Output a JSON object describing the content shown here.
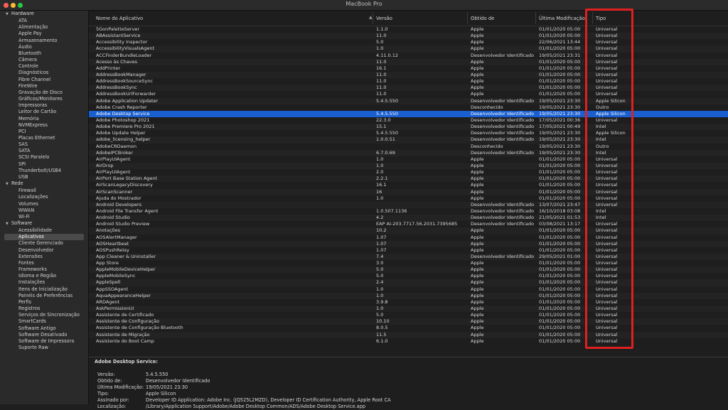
{
  "window": {
    "title": "MacBook Pro"
  },
  "sidebar": {
    "groups": [
      {
        "label": "Hardware",
        "items": [
          "ATA",
          "Alimentação",
          "Apple Pay",
          "Armazenamento",
          "Áudio",
          "Bluetooth",
          "Câmera",
          "Controle",
          "Diagnósticos",
          "Fibre Channel",
          "FireWire",
          "Gravação de Disco",
          "Gráficos/Monitores",
          "Impressoras",
          "Leitor de Cartão",
          "Memória",
          "NVMExpress",
          "PCI",
          "Placas Ethernet",
          "SAS",
          "SATA",
          "SCSI Paralelo",
          "SPI",
          "Thunderbolt/USB4",
          "USB"
        ]
      },
      {
        "label": "Rede",
        "items": [
          "Firewall",
          "Localizações",
          "Volumes",
          "WWAN",
          "Wi-Fi"
        ]
      },
      {
        "label": "Software",
        "items": [
          "Acessibilidade",
          "Aplicativos",
          "Cliente Gerenciado",
          "Desenvolvedor",
          "Extensões",
          "Fontes",
          "Frameworks",
          "Idioma e Região",
          "Instalações",
          "Itens de Inicialização",
          "Painéis de Preferências",
          "Perfis",
          "Registros",
          "Serviços de Sincronização",
          "SmartCards",
          "Software Antigo",
          "Software Desativado",
          "Software de Impressora",
          "Suporte Raw"
        ]
      }
    ],
    "selected": "Aplicativos"
  },
  "table": {
    "columns": [
      "Nome do Aplicativo",
      "Versão",
      "Obtido de",
      "Última Modificação",
      "Tipo"
    ],
    "selected_index": 15,
    "rows": [
      [
        "5GonPaletteServer",
        "1.1.0",
        "Apple",
        "01/01/2020 05:00",
        "Universal"
      ],
      [
        "ABAssistantService",
        "11.0",
        "Apple",
        "01/01/2020 05:00",
        "Universal"
      ],
      [
        "Accessibility Inspector",
        "5.0",
        "Apple",
        "22/06/2021 13:44",
        "Universal"
      ],
      [
        "AccessibilityVisualsAgent",
        "1.0",
        "Apple",
        "01/01/2020 05:00",
        "Universal"
      ],
      [
        "ACCFinderBundleLoader",
        "4.11.0.12",
        "Desenvolvedor Identificado",
        "19/05/2021 23:31",
        "Universal"
      ],
      [
        "Acesso às Chaves",
        "11.0",
        "Apple",
        "01/01/2020 05:00",
        "Universal"
      ],
      [
        "AddPrinter",
        "16.1",
        "Apple",
        "01/01/2020 05:00",
        "Universal"
      ],
      [
        "AddressBookManager",
        "11.0",
        "Apple",
        "01/01/2020 05:00",
        "Universal"
      ],
      [
        "AddressBookSourceSync",
        "11.0",
        "Apple",
        "01/01/2020 05:00",
        "Universal"
      ],
      [
        "AddressBookSync",
        "11.0",
        "Apple",
        "01/01/2020 05:00",
        "Universal"
      ],
      [
        "AddressBookUrlForwarder",
        "11.0",
        "Apple",
        "01/01/2020 05:00",
        "Universal"
      ],
      [
        "Adobe Application Updater",
        "5.4.5.550",
        "Desenvolvedor Identificado",
        "19/05/2021 23:30",
        "Apple Silicon"
      ],
      [
        "Adobe Crash Reporter",
        "",
        "Desconhecido",
        "19/05/2021 23:30",
        "Outro"
      ],
      [
        "Adobe Desktop Service",
        "5.4.5.550",
        "Desenvolvedor Identificado",
        "19/05/2021 23:30",
        "Apple Silicon"
      ],
      [
        "Adobe Photoshop 2021",
        "22.3.0",
        "Desenvolvedor Identificado",
        "17/05/2021 00:36",
        "Universal"
      ],
      [
        "Adobe Premiere Pro 2021",
        "15.1",
        "Desenvolvedor Identificado",
        "17/05/2021 00:49",
        "Intel"
      ],
      [
        "Adobe Update Helper",
        "5.4.5.550",
        "Desenvolvedor Identificado",
        "19/05/2021 23:30",
        "Apple Silicon"
      ],
      [
        "adobe_licensing_helper",
        "1.0.0.51",
        "Desenvolvedor Identificado",
        "19/05/2021 23:30",
        "Intel"
      ],
      [
        "AdobeCRDaemon",
        "",
        "Desconhecido",
        "19/05/2021 23:30",
        "Outro"
      ],
      [
        "AdobeIPCBroker",
        "6.7.0.69",
        "Desenvolvedor Identificado",
        "19/05/2021 23:30",
        "Intel"
      ],
      [
        "AirPlayUIAgent",
        "1.0",
        "Apple",
        "01/01/2020 05:00",
        "Universal"
      ],
      [
        "AirDrop",
        "1.0",
        "Apple",
        "01/01/2020 05:00",
        "Universal"
      ],
      [
        "AirPlayUIAgent",
        "2.0",
        "Apple",
        "01/01/2020 05:00",
        "Universal"
      ],
      [
        "AirPort Base Station Agent",
        "2.2.1",
        "Apple",
        "01/01/2020 05:00",
        "Universal"
      ],
      [
        "AirScanLegacyDiscovery",
        "16.1",
        "Apple",
        "01/01/2020 05:00",
        "Universal"
      ],
      [
        "AirScanScanner",
        "16",
        "Apple",
        "01/01/2020 05:00",
        "Universal"
      ],
      [
        "Ajuda do Mostrador",
        "1.0",
        "Apple",
        "01/01/2020 05:00",
        "Universal"
      ],
      [
        "Android Developers",
        "",
        "Desenvolvedor Identificado",
        "13/07/2021 23:47",
        "Universal"
      ],
      [
        "Android File Transfer Agent",
        "1.0.507.1136",
        "Desenvolvedor Identificado",
        "16/10/2018 03:08",
        "Intel"
      ],
      [
        "Android Studio",
        "4.2",
        "Desenvolvedor Identificado",
        "21/05/2021 01:53",
        "Intel"
      ],
      [
        "Android Studio Preview",
        "EAP AI-203.7717.56.2031.7395685",
        "Desenvolvedor Identificado",
        "03/08/2021 13:17",
        "Universal"
      ],
      [
        "Anotações",
        "10.2",
        "Apple",
        "01/01/2020 05:00",
        "Universal"
      ],
      [
        "AOSAlertManager",
        "1.07",
        "Apple",
        "01/01/2020 05:00",
        "Universal"
      ],
      [
        "AOSHeartbeat",
        "1.07",
        "Apple",
        "01/01/2020 05:00",
        "Universal"
      ],
      [
        "AOSPushRelay",
        "1.07",
        "Apple",
        "01/01/2020 05:00",
        "Universal"
      ],
      [
        "App Cleaner & Uninstaller",
        "7.4",
        "Desenvolvedor Identificado",
        "29/05/2021 01:00",
        "Universal"
      ],
      [
        "App Store",
        "3.0",
        "Apple",
        "01/01/2020 05:00",
        "Universal"
      ],
      [
        "AppleMobileDeviceHelper",
        "5.0",
        "Apple",
        "01/01/2020 05:00",
        "Universal"
      ],
      [
        "AppleMobileSync",
        "5.0",
        "Apple",
        "01/01/2020 05:00",
        "Universal"
      ],
      [
        "AppleSpell",
        "2.4",
        "Apple",
        "01/01/2020 05:00",
        "Universal"
      ],
      [
        "AppSSOAgent",
        "1.0",
        "Apple",
        "01/01/2020 05:00",
        "Universal"
      ],
      [
        "AquaAppearanceHelper",
        "1.0",
        "Apple",
        "01/01/2020 05:00",
        "Universal"
      ],
      [
        "ARDAgent",
        "3.9.8",
        "Apple",
        "01/01/2020 05:00",
        "Universal"
      ],
      [
        "AskPermissionUI",
        "1.0",
        "Apple",
        "01/01/2020 05:00",
        "Universal"
      ],
      [
        "Assistente de Certificado",
        "5.0",
        "Apple",
        "01/01/2020 05:00",
        "Universal"
      ],
      [
        "Assistente de Configuração",
        "10.10",
        "Apple",
        "01/01/2020 05:00",
        "Universal"
      ],
      [
        "Assistente de Configuração Bluetooth",
        "8.0.5",
        "Apple",
        "01/01/2020 05:00",
        "Universal"
      ],
      [
        "Assistente de Migração",
        "11.5",
        "Apple",
        "01/01/2020 05:00",
        "Universal"
      ],
      [
        "Assistente do Boot Camp",
        "6.1.0",
        "Apple",
        "01/01/2020 05:00",
        "Universal"
      ]
    ]
  },
  "details": {
    "title": "Adobe Desktop Service:",
    "fields": [
      {
        "key": "Versão:",
        "value": "5.4.5.550"
      },
      {
        "key": "Obtido de:",
        "value": "Desenvolvedor Identificado"
      },
      {
        "key": "Última Modificação:",
        "value": "19/05/2021 23:30"
      },
      {
        "key": "Tipo:",
        "value": "Apple Silicon"
      },
      {
        "key": "Assinado por:",
        "value": "Developer ID Application: Adobe Inc. (JQ525L2MZD), Developer ID Certification Authority, Apple Root CA"
      },
      {
        "key": "Localização:",
        "value": "/Library/Application Support/Adobe/Adobe Desktop Common/ADS/Adobe Desktop Service.app"
      }
    ]
  },
  "colors": {
    "selection": "#1a5fd0",
    "highlight": "#e02020"
  }
}
